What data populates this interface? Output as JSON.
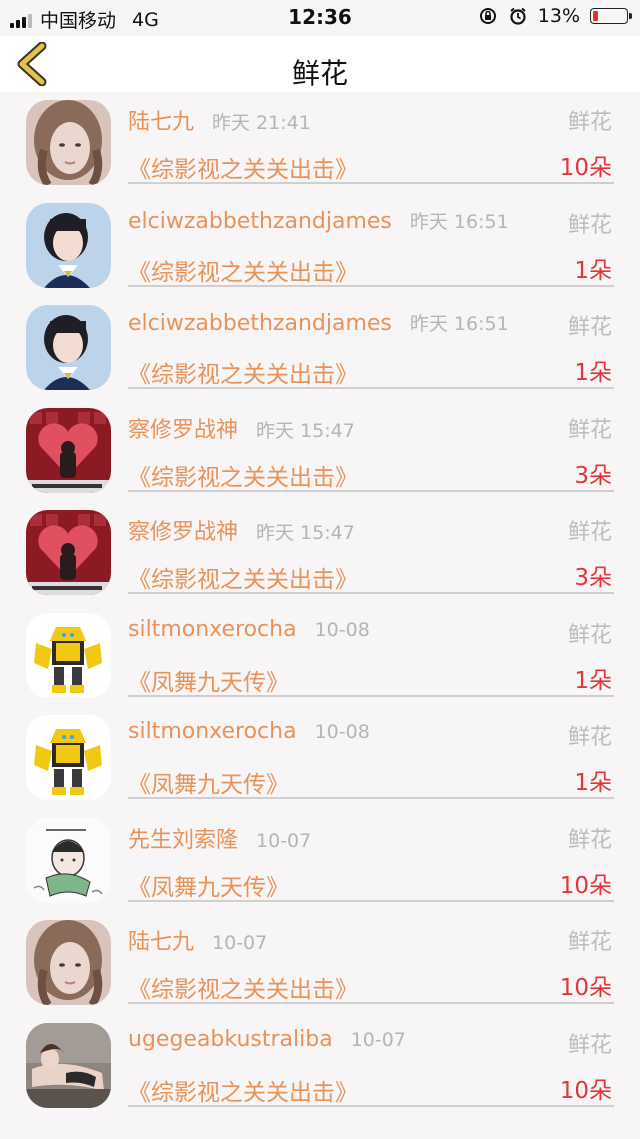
{
  "status": {
    "carrier": "中国移动",
    "network": "4G",
    "time": "12:36",
    "battery": "13%"
  },
  "nav": {
    "title": "鲜花"
  },
  "items": [
    {
      "name": "陆七九",
      "time": "昨天 21:41",
      "kind": "鲜花",
      "book": "《综影视之关关出击》",
      "count": "10朵",
      "avatar": "portrait-girl-icon"
    },
    {
      "name": "elciwzabbethzandjames",
      "time": "昨天 16:51",
      "kind": "鲜花",
      "book": "《综影视之关关出击》",
      "count": "1朵",
      "avatar": "uniform-girl-icon"
    },
    {
      "name": "elciwzabbethzandjames",
      "time": "昨天 16:51",
      "kind": "鲜花",
      "book": "《综影视之关关出击》",
      "count": "1朵",
      "avatar": "uniform-girl-icon"
    },
    {
      "name": "察修罗战神",
      "time": "昨天 15:47",
      "kind": "鲜花",
      "book": "《综影视之关关出击》",
      "count": "3朵",
      "avatar": "heart-wall-icon"
    },
    {
      "name": "察修罗战神",
      "time": "昨天 15:47",
      "kind": "鲜花",
      "book": "《综影视之关关出击》",
      "count": "3朵",
      "avatar": "heart-wall-icon"
    },
    {
      "name": "siltmonxerocha",
      "time": "10-08",
      "kind": "鲜花",
      "book": "《凤舞九天传》",
      "count": "1朵",
      "avatar": "robot-icon"
    },
    {
      "name": "siltmonxerocha",
      "time": "10-08",
      "kind": "鲜花",
      "book": "《凤舞九天传》",
      "count": "1朵",
      "avatar": "robot-icon"
    },
    {
      "name": "先生刘索隆",
      "time": "10-07",
      "kind": "鲜花",
      "book": "《凤舞九天传》",
      "count": "10朵",
      "avatar": "sketch-icon"
    },
    {
      "name": "陆七九",
      "time": "10-07",
      "kind": "鲜花",
      "book": "《综影视之关关出击》",
      "count": "10朵",
      "avatar": "portrait-girl-icon"
    },
    {
      "name": "ugegeabkustraliba",
      "time": "10-07",
      "kind": "鲜花",
      "book": "《综影视之关关出击》",
      "count": "10朵",
      "avatar": "reclining-woman-icon"
    }
  ],
  "colors": {
    "accent": "#e8935a",
    "count": "#e0363a",
    "muted": "#b5b5b5",
    "nav_back": "#d9b23a"
  }
}
